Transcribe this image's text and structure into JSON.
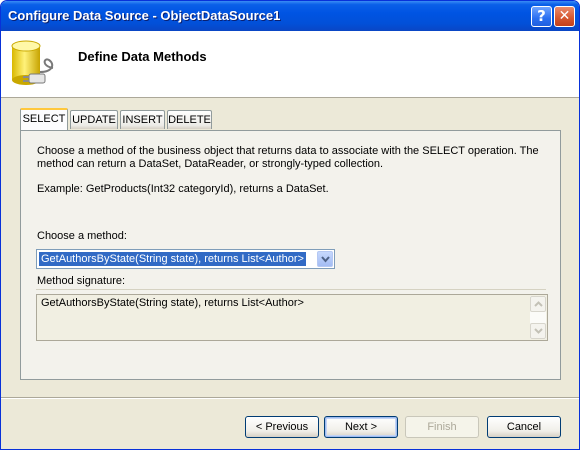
{
  "window": {
    "title": "Configure Data Source - ObjectDataSource1",
    "help_glyph": "?",
    "close_glyph": "✕"
  },
  "header": {
    "title": "Define Data Methods",
    "icon": "database-plug-icon"
  },
  "tabs": [
    {
      "label": "SELECT",
      "active": true
    },
    {
      "label": "UPDATE",
      "active": false
    },
    {
      "label": "INSERT",
      "active": false
    },
    {
      "label": "DELETE",
      "active": false
    }
  ],
  "panel": {
    "description": "Choose a method of the business object that returns data to associate with the SELECT operation. The method can return a DataSet, DataReader, or strongly-typed collection.",
    "example": "Example: GetProducts(Int32 categoryId), returns a DataSet.",
    "choose_method_label": "Choose a method:",
    "selected_method": "GetAuthorsByState(String state), returns List<Author>",
    "signature_label": "Method signature:",
    "signature": "GetAuthorsByState(String state), returns List<Author>"
  },
  "buttons": {
    "previous": "< Previous",
    "next": "Next >",
    "finish": "Finish",
    "cancel": "Cancel"
  },
  "colors": {
    "titlebar": "#0054e3",
    "selection": "#316ac5",
    "active_tab_accent": "#ffc83c"
  }
}
